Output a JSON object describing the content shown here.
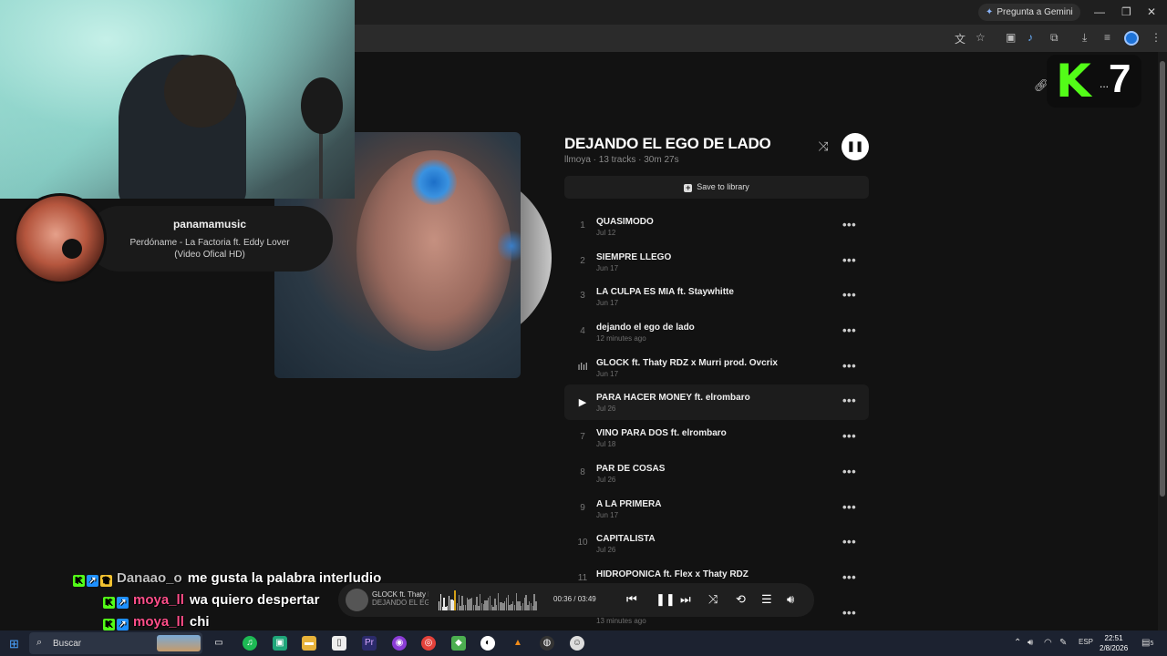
{
  "browser": {
    "gemini_label": "Pregunta a Gemini",
    "profile_color": "#1e73d8"
  },
  "overlay": {
    "username": "panamamusic",
    "song": "Perdóname - La Factoria ft. Eddy Lover (Video Ofical HD)"
  },
  "playlist": {
    "title": "DEJANDO EL EGO DE LADO",
    "meta": "llmoya · 13 tracks · 30m 27s",
    "save_label": "Save to library",
    "tracks": [
      {
        "num": "1",
        "name": "QUASIMODO",
        "date": "Jul 12"
      },
      {
        "num": "2",
        "name": "SIEMPRE LLEGO",
        "date": "Jun 17"
      },
      {
        "num": "3",
        "name": "LA CULPA ES MIA ft. Staywhitte",
        "date": "Jun 17"
      },
      {
        "num": "4",
        "name": "dejando el ego de lado",
        "date": "12 minutes ago"
      },
      {
        "num": "",
        "name": "GLOCK ft. Thaty RDZ x Murri prod. Ovcrix",
        "date": "Jun 17"
      },
      {
        "num": "",
        "name": "PARA HACER MONEY ft. elrombaro",
        "date": "Jul 26"
      },
      {
        "num": "7",
        "name": "VINO PARA DOS ft. elrombaro",
        "date": "Jul 18"
      },
      {
        "num": "8",
        "name": "PAR DE COSAS",
        "date": "Jul 26"
      },
      {
        "num": "9",
        "name": "A LA PRIMERA",
        "date": "Jun 17"
      },
      {
        "num": "10",
        "name": "CAPITALISTA",
        "date": "Jul 26"
      },
      {
        "num": "11",
        "name": "HIDROPONICA ft. Flex x Thaty RDZ",
        "date": ""
      },
      {
        "num": "",
        "name": "",
        "date": "13 minutes ago"
      }
    ],
    "more_glyph": "•••"
  },
  "logo": {
    "letter": "K",
    "dots": "...",
    "number": "7",
    "accent": "#53fc18"
  },
  "chat": [
    {
      "name": "Danaao_o",
      "color": "#bfbfbf",
      "msg": "me gusta la palabra interludio",
      "badges": [
        "k",
        "p",
        "c"
      ]
    },
    {
      "name": "moya_ll",
      "color": "#ff4f8a",
      "msg": "wa quiero despertar",
      "badges": [
        "k",
        "p"
      ]
    },
    {
      "name": "moya_ll",
      "color": "#ff4f8a",
      "msg": "chi",
      "badges": [
        "k",
        "p"
      ]
    }
  ],
  "player": {
    "title": "GLOCK ft. Thaty RDZ x Murri prod. Ovcrix",
    "subtitle": "DEJANDO EL EGO DE LADO",
    "current": "00:36",
    "separator": "/",
    "total": "03:49",
    "progress": 0.16
  },
  "taskbar": {
    "search_placeholder": "Buscar",
    "lang": "ESP",
    "time": "22:51",
    "date": "2/8/2026",
    "notif_count": "5"
  }
}
